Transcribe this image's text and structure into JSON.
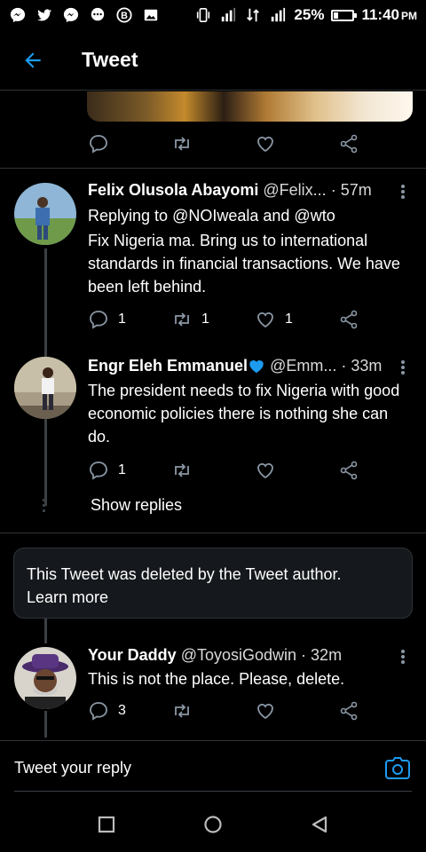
{
  "status_bar": {
    "battery": "25%",
    "battery_level": 0.25,
    "time": "11:40",
    "ampm": "PM"
  },
  "header": {
    "title": "Tweet"
  },
  "tweets": [
    {
      "name": "Felix Olusola Abayomi",
      "handle": "@Felix...",
      "time": "· 57m",
      "replying_prefix": "Replying to ",
      "replying_to": [
        "@NOIweala",
        "@wto"
      ],
      "replying_and": " and ",
      "text": "Fix Nigeria ma. Bring us to international standards in financial transactions. We have been left behind.",
      "replies": "1",
      "retweets": "1",
      "likes": "1"
    },
    {
      "name": "Engr Eleh Emmanuel",
      "handle": "@Emm...",
      "time": "· 33m",
      "text": "The president needs to fix Nigeria with good economic policies there is nothing she can do.",
      "replies": "1",
      "retweets": "",
      "likes": ""
    },
    {
      "name": "Your Daddy",
      "handle": "@ToyosiGodwin",
      "time": "· 32m",
      "text": "This is not the place. Please, delete.",
      "replies": "3",
      "retweets": "",
      "likes": ""
    }
  ],
  "show_replies": "Show replies",
  "deleted": {
    "text": "This Tweet was deleted by the Tweet author.",
    "link": "Learn more"
  },
  "reply_bar": {
    "placeholder": "Tweet your reply"
  },
  "colors": {
    "accent": "#1d9bf0",
    "icon": "#8b98a5",
    "divider": "#2f3336"
  }
}
